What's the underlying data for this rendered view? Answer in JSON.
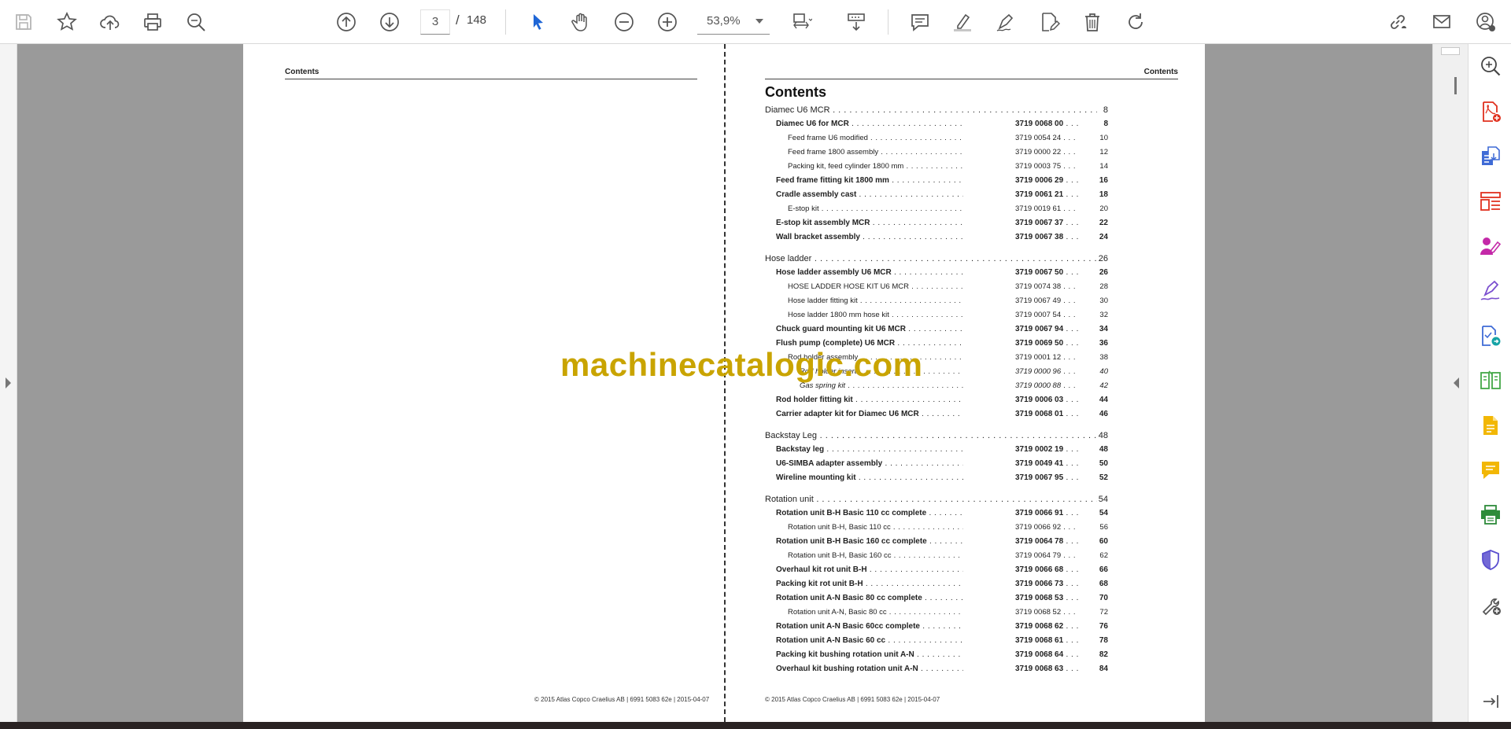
{
  "toolbar": {
    "page_current": "3",
    "page_separator": "/",
    "page_total": "148",
    "zoom": "53,9%",
    "icons": [
      "save-icon",
      "bookmark-star-icon",
      "cloud-upload-icon",
      "print-icon",
      "find-icon",
      "previous-page-icon",
      "next-page-icon",
      "select-cursor-icon",
      "hand-tool-icon",
      "zoom-out-icon",
      "zoom-in-icon",
      "fit-page-icon",
      "scroll-mode-icon",
      "comment-icon",
      "highlight-icon",
      "sign-icon",
      "edit-pdf-icon",
      "delete-icon",
      "rotate-icon",
      "share-link-icon",
      "email-icon",
      "account-icon"
    ]
  },
  "left_page": {
    "header": "Contents",
    "footer": "© 2015 Atlas Copco Craelius AB | 6991 5083 62e | 2015-04-07"
  },
  "right_page": {
    "header": "Contents",
    "title": "Contents",
    "footer": "© 2015 Atlas Copco Craelius AB | 6991 5083 62e | 2015-04-07",
    "toc": [
      {
        "level": 0,
        "title": "Diamec U6 MCR",
        "part": "",
        "page": "8"
      },
      {
        "level": 1,
        "title": "Diamec U6 for MCR",
        "part": "3719 0068 00",
        "page": "8"
      },
      {
        "level": 2,
        "title": "Feed frame U6 modified",
        "part": "3719 0054 24",
        "page": "10"
      },
      {
        "level": 2,
        "title": "Feed frame 1800 assembly",
        "part": "3719 0000 22",
        "page": "12"
      },
      {
        "level": 2,
        "title": "Packing kit, feed cylinder 1800 mm",
        "part": "3719 0003 75",
        "page": "14"
      },
      {
        "level": 1,
        "title": "Feed frame fitting kit 1800 mm",
        "part": "3719 0006 29",
        "page": "16"
      },
      {
        "level": 1,
        "title": "Cradle assembly cast",
        "part": "3719 0061 21",
        "page": "18"
      },
      {
        "level": 2,
        "title": "E-stop kit",
        "part": "3719 0019 61",
        "page": "20"
      },
      {
        "level": 1,
        "title": "E-stop kit assembly MCR",
        "part": "3719 0067 37",
        "page": "22"
      },
      {
        "level": 1,
        "title": "Wall bracket assembly",
        "part": "3719 0067 38",
        "page": "24"
      },
      {
        "level": 0,
        "title": "Hose ladder",
        "part": "",
        "page": "26"
      },
      {
        "level": 1,
        "title": "Hose ladder assembly U6 MCR",
        "part": "3719 0067 50",
        "page": "26"
      },
      {
        "level": 2,
        "title": "HOSE LADDER HOSE KIT U6 MCR",
        "part": "3719 0074 38",
        "page": "28"
      },
      {
        "level": 2,
        "title": "Hose ladder fitting kit",
        "part": "3719 0067 49",
        "page": "30"
      },
      {
        "level": 2,
        "title": "Hose ladder 1800 mm hose kit",
        "part": "3719 0007 54",
        "page": "32"
      },
      {
        "level": 1,
        "title": "Chuck guard mounting kit U6 MCR",
        "part": "3719 0067 94",
        "page": "34"
      },
      {
        "level": 1,
        "title": "Flush pump (complete) U6 MCR",
        "part": "3719 0069 50",
        "page": "36"
      },
      {
        "level": 2,
        "title": "Rod holder assembly",
        "part": "3719 0001 12",
        "page": "38"
      },
      {
        "level": 3,
        "title": "Rod holder insert",
        "part": "3719 0000 96",
        "page": "40"
      },
      {
        "level": 3,
        "title": "Gas spring kit",
        "part": "3719 0000 88",
        "page": "42"
      },
      {
        "level": 1,
        "title": "Rod holder fitting kit",
        "part": "3719 0006 03",
        "page": "44"
      },
      {
        "level": 1,
        "title": "Carrier adapter kit for Diamec U6 MCR",
        "part": "3719 0068 01",
        "page": "46"
      },
      {
        "level": 0,
        "title": "Backstay Leg",
        "part": "",
        "page": "48"
      },
      {
        "level": 1,
        "title": "Backstay leg",
        "part": "3719 0002 19",
        "page": "48"
      },
      {
        "level": 1,
        "title": "U6-SIMBA adapter assembly",
        "part": "3719 0049 41",
        "page": "50"
      },
      {
        "level": 1,
        "title": "Wireline mounting kit",
        "part": "3719 0067 95",
        "page": "52"
      },
      {
        "level": 0,
        "title": "Rotation unit",
        "part": "",
        "page": "54"
      },
      {
        "level": 1,
        "title": "Rotation unit B-H Basic 110 cc complete",
        "part": "3719 0066 91",
        "page": "54"
      },
      {
        "level": 2,
        "title": "Rotation unit B-H, Basic 110 cc",
        "part": "3719 0066 92",
        "page": "56"
      },
      {
        "level": 1,
        "title": "Rotation unit B-H Basic 160 cc complete",
        "part": "3719 0064 78",
        "page": "60"
      },
      {
        "level": 2,
        "title": "Rotation unit B-H, Basic 160 cc",
        "part": "3719 0064 79",
        "page": "62"
      },
      {
        "level": 1,
        "title": "Overhaul kit rot unit B-H",
        "part": "3719 0066 68",
        "page": "66"
      },
      {
        "level": 1,
        "title": "Packing kit rot unit B-H",
        "part": "3719 0066 73",
        "page": "68"
      },
      {
        "level": 1,
        "title": "Rotation unit A-N Basic 80 cc complete",
        "part": "3719 0068 53",
        "page": "70"
      },
      {
        "level": 2,
        "title": "Rotation unit A-N, Basic 80 cc",
        "part": "3719 0068 52",
        "page": "72"
      },
      {
        "level": 1,
        "title": "Rotation unit A-N Basic 60cc complete",
        "part": "3719 0068 62",
        "page": "76"
      },
      {
        "level": 1,
        "title": "Rotation unit A-N Basic 60 cc",
        "part": "3719 0068 61",
        "page": "78"
      },
      {
        "level": 1,
        "title": "Packing kit bushing rotation unit A-N",
        "part": "3719 0068 64",
        "page": "82"
      },
      {
        "level": 1,
        "title": "Overhaul kit bushing rotation unit A-N",
        "part": "3719 0068 63",
        "page": "84"
      }
    ]
  },
  "watermark": "machinecatalogic.com",
  "tools_panel": {
    "icons": [
      "zoom-search-icon",
      "create-pdf-icon",
      "export-pdf-icon",
      "organize-pages-icon",
      "fill-sign-icon",
      "signature-icon",
      "send-for-review-icon",
      "compare-files-icon",
      "edit-document-icon",
      "comment-tool-icon",
      "print-production-icon",
      "protect-icon",
      "more-tools-icon",
      "collapse-panel-icon"
    ],
    "colors": {
      "red": "#e0301e",
      "blue": "#3f6bd6",
      "magenta": "#c429a8",
      "purple": "#7b4fcf",
      "teal": "#15a3a6",
      "green": "#44a847",
      "orange": "#e59c1b",
      "yellow": "#f2b705",
      "darkgreen": "#2e8b3a",
      "indigo": "#5a4fcf",
      "gray": "#555555"
    }
  }
}
